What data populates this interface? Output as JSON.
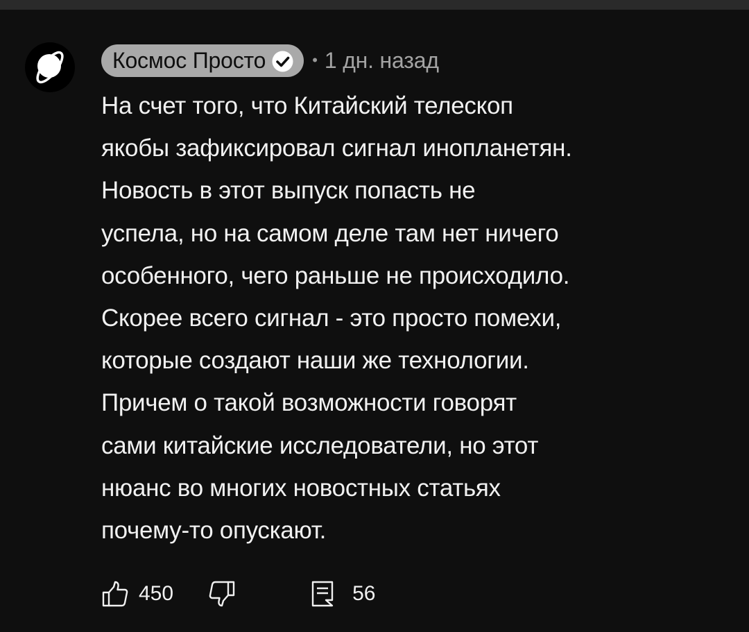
{
  "comment": {
    "author": "Космос Просто",
    "verified": true,
    "separator": "•",
    "timestamp": "1 дн. назад",
    "body_lines": [
      "На счет того, что Китайский телескоп",
      "якобы зафиксировал сигнал инопланетян.",
      "Новость в этот выпуск попасть не",
      "успела, но на самом деле там нет ничего",
      "особенного, чего раньше не происходило.",
      "Скорее всего сигнал - это просто помехи,",
      "которые создают наши же технологии.",
      "Причем о такой возможности говорят",
      "сами китайские исследователи, но этот",
      "нюанс во многих новостных статьях",
      "почему-то опускают."
    ],
    "likes": "450",
    "replies": "56"
  },
  "icons": {
    "avatar": "planet-logo-icon",
    "verified": "verified-check-icon",
    "like": "thumb-up-icon",
    "dislike": "thumb-down-icon",
    "reply": "comment-icon"
  },
  "colors": {
    "background": "#0f0f0f",
    "author_chip": "#a9a9a9",
    "text": "#f1f1f1",
    "secondary_text": "#a4a4a4"
  }
}
